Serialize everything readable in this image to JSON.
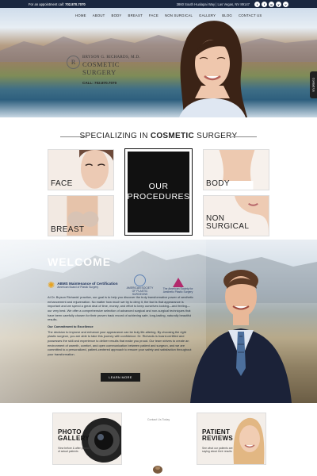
{
  "topbar": {
    "appointment_label": "For an appointment call:",
    "appointment_phone": "702.870.7070",
    "address": "3860 South Hualapai Way | Las Vegas, NV 89147",
    "social": [
      "t",
      "f",
      "g",
      "y",
      "v"
    ]
  },
  "nav": {
    "items": [
      "HOME",
      "ABOUT",
      "BODY",
      "BREAST",
      "FACE",
      "NON SURGICAL",
      "GALLERY",
      "BLOG",
      "CONTACT US"
    ]
  },
  "hero": {
    "logo_name": "BRYSON G. RICHARDS, M.D.",
    "logo_sub": "COSMETIC SURGERY",
    "logo_monogram": "R",
    "call": "CALL: 702.870.7070",
    "side_tab": "Contact Us"
  },
  "specializing": {
    "prefix": "SPECIALIZING IN",
    "emphasis": "COSMETIC",
    "suffix": "SURGERY"
  },
  "tiles": {
    "face": "FACE",
    "breast": "BREAST",
    "body": "BODY",
    "non_surgical_1": "NON",
    "non_surgical_2": "SURGICAL",
    "procedures_1": "OUR",
    "procedures_2": "PROCEDURES"
  },
  "welcome": {
    "title": "WELCOME",
    "abms_title": "ABMS Maintenance of Certification",
    "abms_sub": "American Board of Plastic Surgery",
    "asps": "AMERICAN SOCIETY OF PLASTIC SURGEONS",
    "asaps": "The American Society for Aesthetic Plastic Surgery",
    "para1": "At Dr. Bryson Richards' practice, our goal is to help you discover the truly transformative power of aesthetic enhancement and rejuvenation. No matter how much we try to deny it, the fact is that appearance is important and we spend a great deal of time, money, and effort to keep ourselves looking—and feeling—our very best. We offer a comprehensive selection of advanced surgical and non-surgical techniques that have been carefully chosen for their proven track record of achieving safe, long-lasting, naturally beautiful results.",
    "subhead": "Our Commitment to Excellence",
    "para2": "The decision to improve and enhance your appearance can be truly life-altering. By choosing the right plastic surgeon, you are able to take this journey with confidence. Dr. Richards is board-certified and possesses the skill and experience to deliver results that make you proud. Our team strives to create an environment of warmth, comfort, and open communication between patient and surgeon, and we are committed to a personalized, patient-centered approach to ensure your safety and satisfaction throughout your transformation.",
    "button": "LEARN MORE"
  },
  "bottom": {
    "center_text": "Contact Us Today",
    "gallery_title_1": "PHOTO",
    "gallery_title_2": "GALLERY",
    "gallery_desc": "View before & after photos of actual patients",
    "reviews_title_1": "PATIENT",
    "reviews_title_2": "REVIEWS",
    "reviews_desc": "See what our patients are saying about their results"
  },
  "colors": {
    "topbar": "#1a2740",
    "accent_dark": "#111111",
    "asaps": "#b2296c",
    "abms_star": "#e7a31f"
  }
}
